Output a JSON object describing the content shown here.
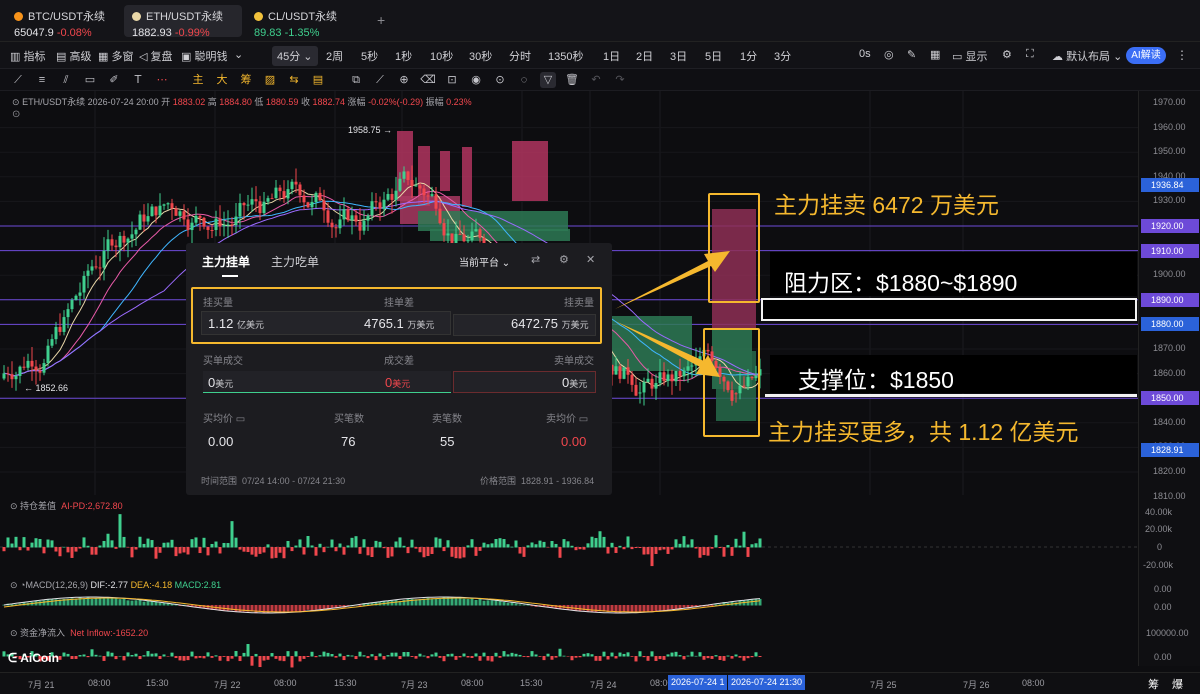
{
  "tabs": [
    {
      "symbol": "BTC/USDT永续",
      "price": "65047.9",
      "change": "-0.08%",
      "dot_color": "#f7931a"
    },
    {
      "symbol": "ETH/USDT永续",
      "price": "1882.93",
      "change": "-0.99%",
      "dot_color": "#e9d7a8"
    },
    {
      "symbol": "CL/USDT永续",
      "price": "89.83",
      "change": "-1.35%",
      "dot_color": "#f2c23c"
    }
  ],
  "tab_add": "+",
  "toolbar": {
    "indicator": "指标",
    "advanced": "高级",
    "multi_window": "多窗",
    "replay": "复盘",
    "smart_money": "聪明钱",
    "selected_interval": "45分",
    "intervals": [
      "2周",
      "5秒",
      "1秒",
      "10秒",
      "30秒",
      "分时",
      "1350秒",
      "1日",
      "2日",
      "3日",
      "5日",
      "1分",
      "3分"
    ],
    "right_interval": "0s",
    "display": "显示",
    "layout": "默认布局",
    "ai_label": "AI解读"
  },
  "drawbar": {
    "main": "主",
    "big": "大",
    "chip": "筹"
  },
  "legend": {
    "symbol": "ETH/USDT永续",
    "datetime": "2026-07-24 20:00",
    "open_label": "开",
    "open": "1883.02",
    "high_label": "高",
    "high": "1884.80",
    "low_label": "低",
    "low": "1880.59",
    "close_label": "收",
    "close": "1882.74",
    "chg_label": "涨幅",
    "chg": "-0.02%(-0.29)",
    "amp_label": "振幅",
    "amp": "0.23%"
  },
  "markers": {
    "high": "1958.75",
    "low": "1852.66"
  },
  "yaxis": {
    "ticks": [
      "1970.00",
      "1960.00",
      "1950.00",
      "1940.00",
      "1930.00",
      "1920.00",
      "1910.00",
      "1900.00",
      "1890.00",
      "1880.00",
      "1870.00",
      "1860.00",
      "1850.00",
      "1840.00",
      "1830.00",
      "1820.00",
      "1810.00"
    ],
    "badges": [
      {
        "value": "1936.84",
        "color": "#2b62d9",
        "price": 1936.84
      },
      {
        "value": "1920.00",
        "color": "#6d4ad8",
        "price": 1920
      },
      {
        "value": "1910.00",
        "color": "#6d4ad8",
        "price": 1910
      },
      {
        "value": "1890.00",
        "color": "#6d4ad8",
        "price": 1890
      },
      {
        "value": "1880.00",
        "color": "#2b62d9",
        "price": 1880
      },
      {
        "value": "1850.00",
        "color": "#6d4ad8",
        "price": 1850
      },
      {
        "value": "1828.91",
        "color": "#2b62d9",
        "price": 1828.91
      }
    ]
  },
  "panel": {
    "tab_active": "主力挂单",
    "tab_other": "主力吃单",
    "platform": "当前平台",
    "buy_qty_label": "挂买量",
    "diff_label": "挂单差",
    "sell_qty_label": "挂卖量",
    "buy_qty": "1.12",
    "buy_qty_unit": "亿美元",
    "diff": "4765.1",
    "diff_unit": "万美元",
    "sell_qty": "6472.75",
    "sell_qty_unit": "万美元",
    "buy_fill_label": "买单成交",
    "fill_diff_label": "成交差",
    "sell_fill_label": "卖单成交",
    "buy_fill": "0",
    "fill_diff": "0",
    "sell_fill": "0",
    "unit": "美元",
    "avg_buy_label": "买均价",
    "buy_count_label": "买笔数",
    "sell_count_label": "卖笔数",
    "avg_sell_label": "卖均价",
    "avg_buy": "0.00",
    "buy_count": "76",
    "sell_count": "55",
    "avg_sell": "0.00",
    "time_range_label": "时间范围",
    "time_range": "07/24 14:00 - 07/24 21:30",
    "price_range_label": "价格范围",
    "price_range": "1828.91 - 1936.84"
  },
  "annotations": {
    "sell": "主力挂卖 6472 万美元",
    "resistance": "阻力区：$1880~$1890",
    "support": "支撑位：$1850",
    "buy": "主力挂买更多，共 1.12 亿美元"
  },
  "sub1": {
    "title": "持仓差值",
    "value": "AI-PD:2,672.80",
    "ticks": [
      "40.00k",
      "20.00k",
      "0",
      "-20.00k"
    ]
  },
  "sub2": {
    "title": "MACD(12,26,9)",
    "dif": "DIF:-2.77",
    "dea": "DEA:-4.18",
    "macd": "MACD:2.81",
    "ticks": [
      "0.00",
      "0.00"
    ]
  },
  "sub3": {
    "title": "资金净流入",
    "value": "Net Inflow:-1652.20",
    "ticks": [
      "100000.00",
      "0.00"
    ]
  },
  "brand": "AiCoin",
  "xaxis": {
    "labels": [
      "7月 21",
      "08:00",
      "15:30",
      "7月 22",
      "08:00",
      "15:30",
      "7月 23",
      "08:00",
      "15:30",
      "7月 24",
      "08:00",
      "7月 25",
      "7月 26",
      "08:00"
    ],
    "cursor1": "2026-07-24 1",
    "cursor2": "2026-07-24 21:30",
    "right_btn1": "筹",
    "right_btn2": "爆"
  },
  "colors": {
    "up": "#3fcf8e",
    "down": "#f0474d",
    "accent": "#f5b82e",
    "panel": "#1c1c20"
  }
}
